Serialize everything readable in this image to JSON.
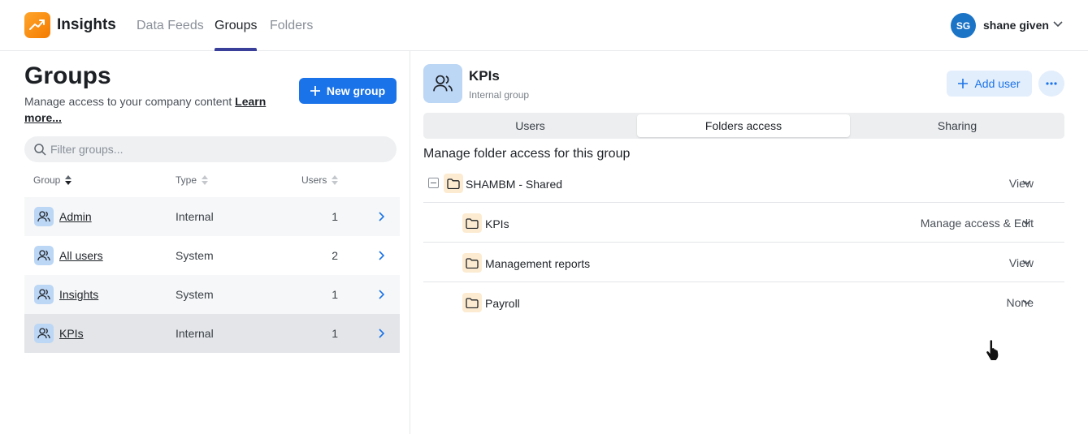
{
  "app": {
    "name": "Insights",
    "brand_color": "#f7931e"
  },
  "nav": {
    "tabs": [
      {
        "label": "Data Feeds"
      },
      {
        "label": "Groups"
      },
      {
        "label": "Folders"
      }
    ],
    "active": "Groups"
  },
  "user": {
    "initials": "SG",
    "name": "shane given"
  },
  "groups_page": {
    "title": "Groups",
    "description": "Manage access to your company content",
    "learn_more": "Learn more...",
    "new_group_label": "New group",
    "filter_placeholder": "Filter groups...",
    "columns": [
      "Group",
      "Type",
      "Users"
    ],
    "rows": [
      {
        "name": "Admin",
        "type": "Internal",
        "users": "1"
      },
      {
        "name": "All users",
        "type": "System",
        "users": "2"
      },
      {
        "name": "Insights",
        "type": "System",
        "users": "1"
      },
      {
        "name": "KPIs",
        "type": "Internal",
        "users": "1"
      }
    ]
  },
  "detail": {
    "title": "KPIs",
    "subtitle": "Internal group",
    "add_user_label": "Add user",
    "tabs": [
      {
        "label": "Users"
      },
      {
        "label": "Folders access"
      },
      {
        "label": "Sharing"
      }
    ],
    "active_tab": "Folders access",
    "section_title": "Manage folder access for this group",
    "folders": [
      {
        "name": "SHAMBM - Shared",
        "permission": "View"
      },
      {
        "name": "KPIs",
        "permission": "Manage access & Edit"
      },
      {
        "name": "Management reports",
        "permission": "View"
      },
      {
        "name": "Payroll",
        "permission": "None"
      }
    ]
  }
}
